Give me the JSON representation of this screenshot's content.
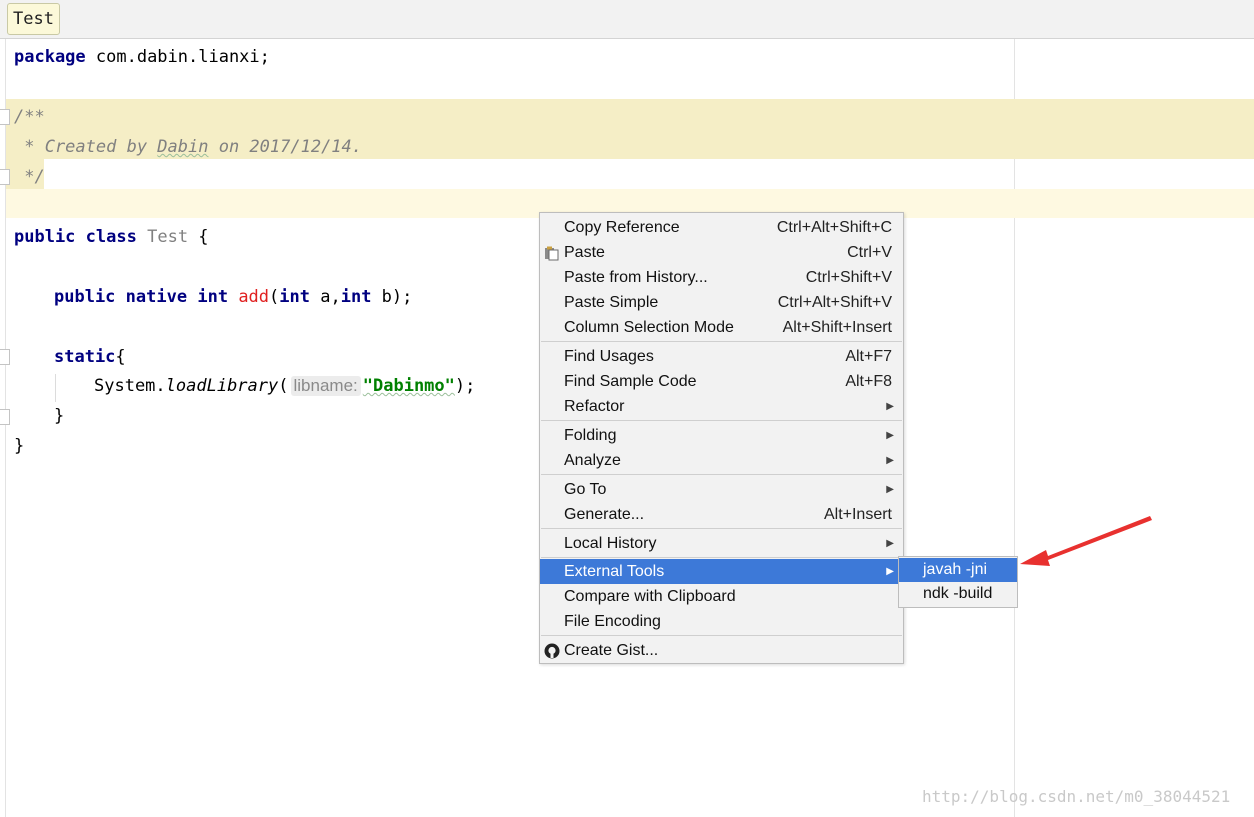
{
  "tab": {
    "title": "Test"
  },
  "code": {
    "line1": {
      "kw": "package",
      "rest": " com.dabin.lianxi;"
    },
    "comment": {
      "open": "/**",
      "pre": " * Created by ",
      "author": "Dabin",
      "post": " on 2017/12/14.",
      "close": " */"
    },
    "class_decl": {
      "kw1": "public",
      "kw2": "class",
      "name": "Test",
      "brace": " {"
    },
    "method_decl": {
      "kw1": "public",
      "kw2": "native",
      "kw3": "int",
      "name": "add",
      "p_open": "(",
      "t1": "int",
      "a": " a,",
      "t2": "int",
      "b": " b);"
    },
    "static_decl": {
      "kw": "static",
      "brace": "{"
    },
    "load_call": {
      "obj": "System.",
      "method": "loadLibrary",
      "open": "(",
      "hint": "libname:",
      "str": "\"Dabinmo\"",
      "close": ");"
    },
    "close_inner": "}",
    "close_outer": "}"
  },
  "menu": {
    "items": [
      {
        "label": "Copy Reference",
        "shortcut": "Ctrl+Alt+Shift+C"
      },
      {
        "label": "Paste",
        "shortcut": "Ctrl+V",
        "icon": "clipboard-icon"
      },
      {
        "label": "Paste from History...",
        "shortcut": "Ctrl+Shift+V"
      },
      {
        "label": "Paste Simple",
        "shortcut": "Ctrl+Alt+Shift+V"
      },
      {
        "label": "Column Selection Mode",
        "shortcut": "Alt+Shift+Insert"
      },
      {
        "label": "Find Usages",
        "shortcut": "Alt+F7"
      },
      {
        "label": "Find Sample Code",
        "shortcut": "Alt+F8"
      },
      {
        "label": "Refactor",
        "submenu": true
      },
      {
        "label": "Folding",
        "submenu": true
      },
      {
        "label": "Analyze",
        "submenu": true
      },
      {
        "label": "Go To",
        "submenu": true
      },
      {
        "label": "Generate...",
        "shortcut": "Alt+Insert"
      },
      {
        "label": "Local History",
        "submenu": true
      },
      {
        "label": "External Tools",
        "submenu": true,
        "selected": true
      },
      {
        "label": "Compare with Clipboard"
      },
      {
        "label": "File Encoding"
      },
      {
        "label": "Create Gist...",
        "icon": "github-icon"
      }
    ]
  },
  "submenu": {
    "items": [
      {
        "label": "javah -jni",
        "selected": true
      },
      {
        "label": "ndk -build"
      }
    ]
  },
  "colors": {
    "selection": "#3d79d8",
    "arrow": "#e8312f",
    "comment_highlight": "#f5eec6"
  },
  "watermark": "http://blog.csdn.net/m0_38044521"
}
